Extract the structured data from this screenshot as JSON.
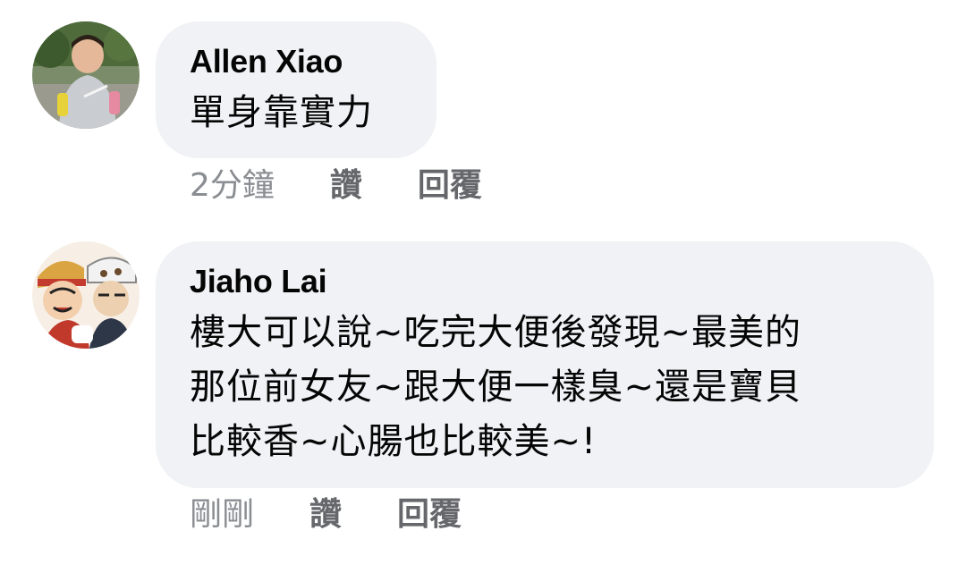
{
  "comments": [
    {
      "author": "Allen Xiao",
      "text": "單身靠實力",
      "time": "2分鐘",
      "like_label": "讚",
      "reply_label": "回覆"
    },
    {
      "author": "Jiaho Lai",
      "text": "樓大可以說~吃完大便後發現~最美的\n那位前女友~跟大便一樣臭~還是寶貝\n比較香~心腸也比較美~!",
      "time": "剛剛",
      "like_label": "讚",
      "reply_label": "回覆"
    }
  ],
  "colors": {
    "bubble_bg": "#f0f2f5",
    "text": "#050505",
    "meta": "#65676b"
  },
  "icons": {
    "avatar_1": "user-photo-avatar",
    "avatar_2": "cartoon-characters-avatar"
  }
}
